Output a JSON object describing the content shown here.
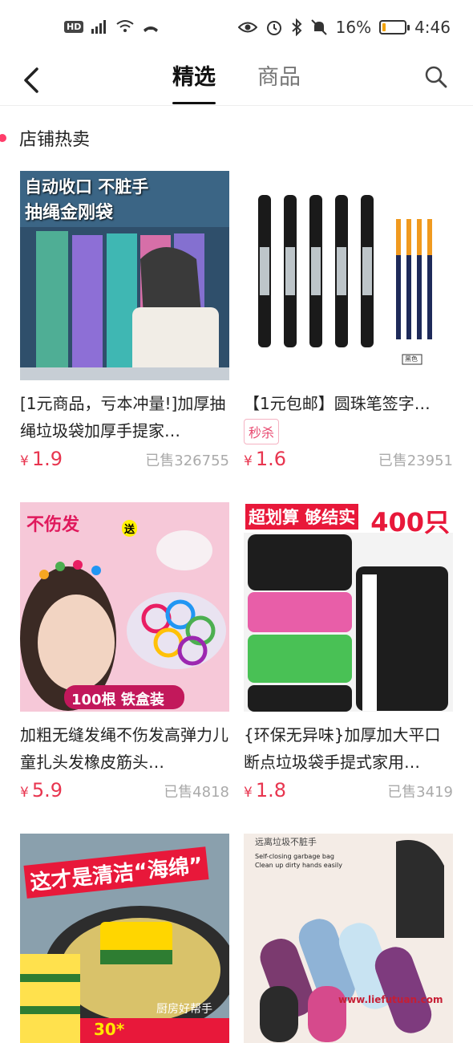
{
  "status_bar": {
    "left": "HD 4G",
    "battery": "16%",
    "time": "4:46",
    "battery_level": 0.16
  },
  "nav": {
    "tabs": [
      "精选",
      "商品"
    ],
    "active_tab": 0
  },
  "section": {
    "title": "店铺热卖"
  },
  "products": [
    {
      "title": "[1元商品，亏本冲量!]加厚抽绳垃圾袋加厚手提家…",
      "badge": "",
      "price_symbol": "¥",
      "price": "1.9",
      "sold": "已售326755",
      "image_text": [
        "自动收口 不脏手",
        "抽绳金刚袋"
      ]
    },
    {
      "title": "【1元包邮】圆珠笔签字…",
      "badge": "秒杀",
      "price_symbol": "¥",
      "price": "1.6",
      "sold": "已售23951",
      "image_text": [
        "黑色"
      ]
    },
    {
      "title": "加粗无缝发绳不伤发高弹力儿童扎头发橡皮筋头…",
      "badge": "",
      "price_symbol": "¥",
      "price": "5.9",
      "sold": "已售4818",
      "image_text": [
        "不伤发",
        "送",
        "100根 铁盒装"
      ]
    },
    {
      "title": "{环保无异味}加厚加大平口断点垃圾袋手提式家用…",
      "badge": "",
      "price_symbol": "¥",
      "price": "1.8",
      "sold": "已售3419",
      "image_text": [
        "超划算 够结实",
        "400只"
      ]
    },
    {
      "title": "",
      "badge": "",
      "price_symbol": "",
      "price": "",
      "sold": "",
      "image_text": [
        "这才是清洁“海绵”",
        "厨房好帮手",
        "30*"
      ]
    },
    {
      "title": "",
      "badge": "",
      "price_symbol": "",
      "price": "",
      "sold": "",
      "image_text": [
        "远离垃圾不脏手",
        "Self-closing garbage bag",
        "Clean up dirty hands easily",
        "www.liefutuan.com"
      ]
    }
  ]
}
